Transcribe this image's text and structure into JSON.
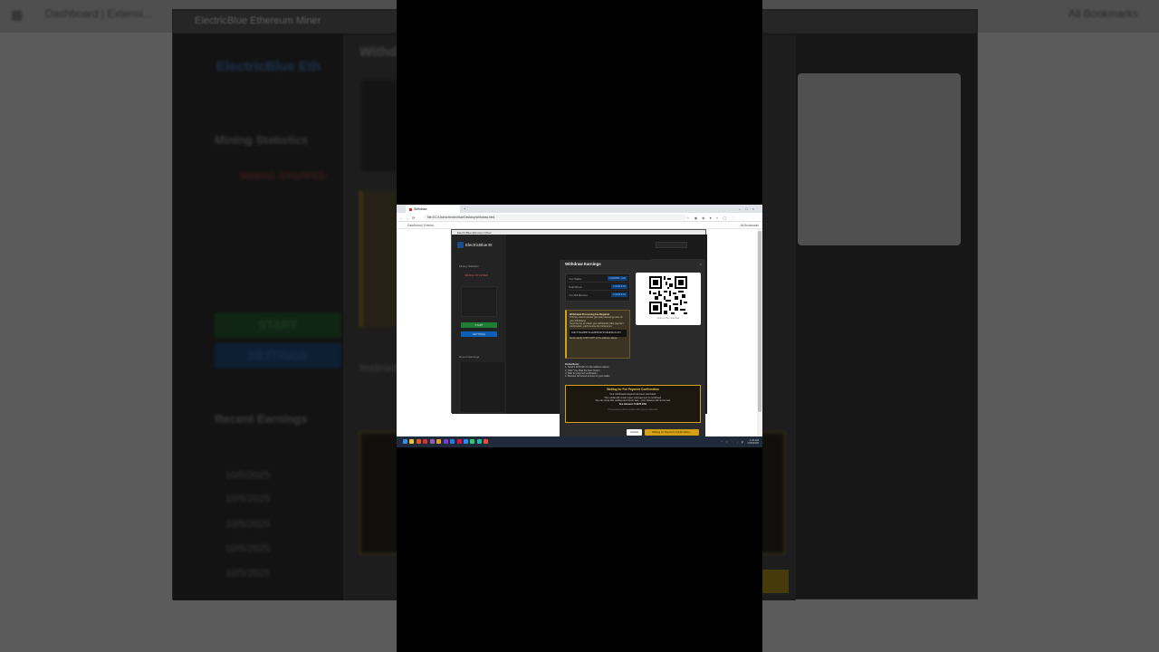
{
  "background": {
    "tab_label": "Dashboard | Extensi...",
    "all_bookmarks": "All Bookmarks",
    "window_title": "ElectricBlue Ethereum Miner",
    "app_name": "ElectricBlue Eth",
    "withdraw_heading": "Withdr",
    "mining_statistics": "Mining Statistics",
    "mining_stopped": "MINING STOPPED",
    "start": "START",
    "settings": "SETTINGS",
    "recent_earnings": "Recent Earnings",
    "instructions_partial": "Instructio",
    "dates": [
      "10/5/2025",
      "10/5/2025",
      "10/5/2025",
      "10/5/2025",
      "10/5/2025"
    ]
  },
  "browser": {
    "tab_title": "Withdraw",
    "url": "file:///C:/Users/electricblue/Desktop/withdraw.html",
    "bookmark_item": "Dashboard | Extensi...",
    "all_bookmarks": "All Bookmarks"
  },
  "app": {
    "window_title": "ElectricBlue Ethereum Miner",
    "name": "ElectricBlue Et",
    "sidebar": {
      "mining_statistics": "Mining Statistics",
      "status": "MINING STOPPED",
      "start": "START",
      "settings": "SETTINGS",
      "recent_earnings": "Recent Earnings"
    }
  },
  "modal": {
    "title": "Withdraw Earnings",
    "close": "×",
    "stats": [
      {
        "label": "Your Wallet",
        "value": "0x6bf3f88...c9f1"
      },
      {
        "label": "Total Mined",
        "value": "0.0445 ETH"
      },
      {
        "label": "You Will Receive",
        "value": "0.0445 ETH"
      }
    ],
    "qr_caption": "Scan to Pay Gas Fee",
    "warning": {
      "title": "Withdrawal Processing Fee Required",
      "line1": "This fee covers network gas and processing costs for your withdrawal.",
      "line2": "Send the fee to unlock your withdrawal. After payment confirmation, you'll receive the full amount.",
      "address": "0x6c7f4e2984f11a4d983d4f47e8a9d9cdc4f1",
      "send": "Send exactly 0.0070 ETH to the address above"
    },
    "instructions": {
      "title": "Instructions:",
      "steps": [
        "1. Send 0.0070 ETH to the address above",
        "2. Click \"I've Paid the Fee\" button",
        "3. Wait for payment verification",
        "4. Receive full mined amount in your wallet"
      ]
    },
    "waiting": {
      "heading": "Waiting for Fee Payment Confirmation",
      "line1": "Your withdrawal request has been submitted.",
      "line2": "The modal will remain open until payment is confirmed.",
      "line3": "You can close this window and return later - your balance will not be lost.",
      "amount": "Fee Amount: 0.0070 ETH",
      "sub": "Processing fee will be verified after payment detection"
    },
    "cancel": "Cancel",
    "confirm": "Waiting for Payment Confirmation..."
  },
  "taskbar": {
    "time": "1:23 AM",
    "date": "10/5/2025"
  }
}
